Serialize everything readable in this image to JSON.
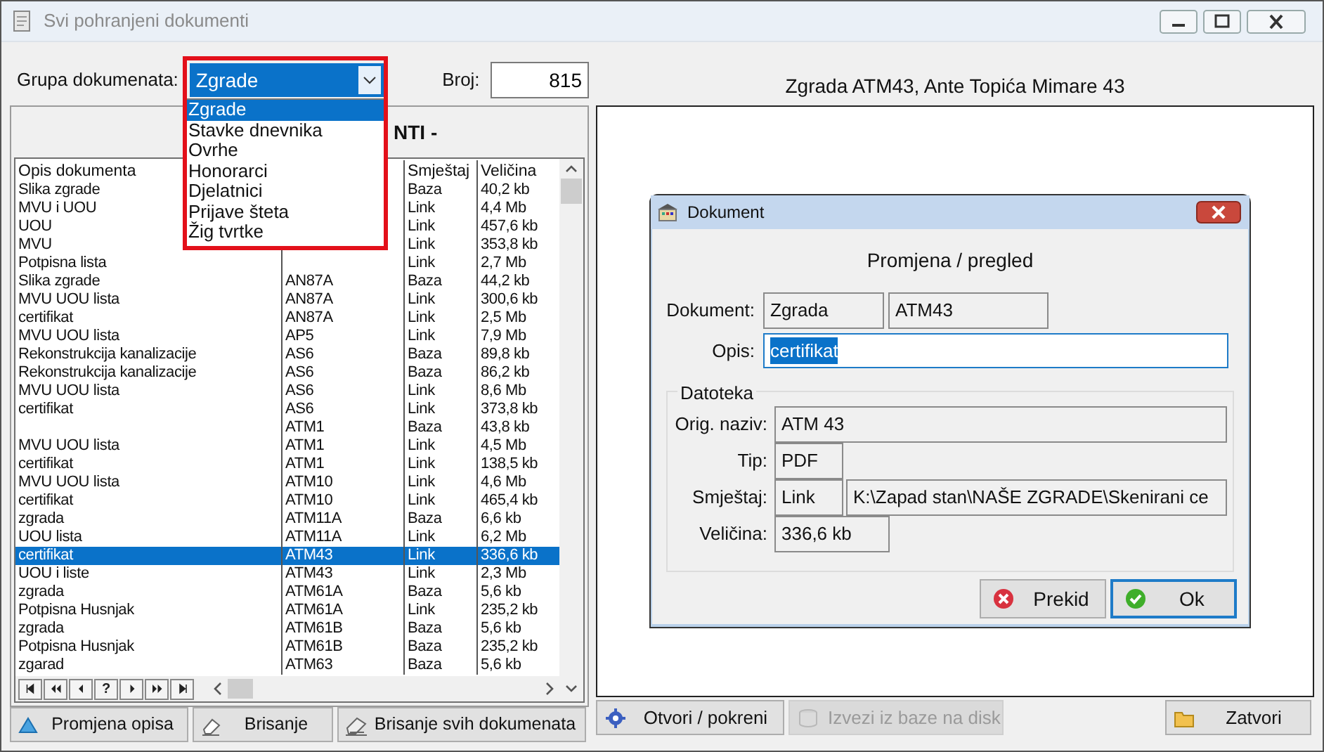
{
  "window": {
    "title": "Svi pohranjeni dokumenti"
  },
  "group_selector": {
    "label": "Grupa dokumenata:",
    "value": "Zgrade",
    "expanded": true,
    "options": [
      {
        "label": "Zgrade",
        "selected": true
      },
      {
        "label": "Stavke dnevnika",
        "selected": false
      },
      {
        "label": "Ovrhe",
        "selected": false
      },
      {
        "label": "Honorarci",
        "selected": false
      },
      {
        "label": "Djelatnici",
        "selected": false
      },
      {
        "label": "Prijave šteta",
        "selected": false
      },
      {
        "label": "Žig tvrtke",
        "selected": false
      }
    ]
  },
  "count": {
    "label": "Broj:",
    "value": "815"
  },
  "list_panel": {
    "heading": "NTI -",
    "columns": {
      "description": "Opis dokumenta",
      "location": "Smještaj",
      "size": "Veličina"
    },
    "rows": [
      {
        "description": "Slika zgrade",
        "location": "Baza",
        "size": "40,2 kb",
        "selected": false
      },
      {
        "description": "MVU i UOU",
        "location": "Link",
        "size": "4,4 Mb",
        "selected": false
      },
      {
        "description": "UOU",
        "location": "Link",
        "size": "457,6 kb",
        "selected": false
      },
      {
        "description": "MVU",
        "location": "Link",
        "size": "353,8 kb",
        "selected": false
      },
      {
        "description": "Potpisna lista",
        "location": "Link",
        "size": "2,7 Mb",
        "selected": false
      },
      {
        "description": "Slika zgrade",
        "code": "AN87A",
        "location": "Baza",
        "size": "44,2 kb",
        "selected": false
      },
      {
        "description": "MVU UOU lista",
        "code": "AN87A",
        "location": "Link",
        "size": "300,6 kb",
        "selected": false
      },
      {
        "description": "certifikat",
        "code": "AN87A",
        "location": "Link",
        "size": "2,5 Mb",
        "selected": false
      },
      {
        "description": "MVU UOU lista",
        "code": "AP5",
        "location": "Link",
        "size": "7,9 Mb",
        "selected": false
      },
      {
        "description": "Rekonstrukcija kanalizacije",
        "code": "AS6",
        "location": "Baza",
        "size": "89,8 kb",
        "selected": false
      },
      {
        "description": "Rekonstrukcija kanalizacije",
        "code": "AS6",
        "location": "Baza",
        "size": "86,2 kb",
        "selected": false
      },
      {
        "description": "MVU UOU lista",
        "code": "AS6",
        "location": "Link",
        "size": "8,6 Mb",
        "selected": false
      },
      {
        "description": "certifikat",
        "code": "AS6",
        "location": "Link",
        "size": "373,8 kb",
        "selected": false
      },
      {
        "code": "ATM1",
        "location": "Baza",
        "size": "43,8 kb",
        "selected": false
      },
      {
        "description": "MVU UOU lista",
        "code": "ATM1",
        "location": "Link",
        "size": "4,5 Mb",
        "selected": false
      },
      {
        "description": "certifikat",
        "code": "ATM1",
        "location": "Link",
        "size": "138,5 kb",
        "selected": false
      },
      {
        "description": "MVU UOU lista",
        "code": "ATM10",
        "location": "Link",
        "size": "4,6 Mb",
        "selected": false
      },
      {
        "description": "certifikat",
        "code": "ATM10",
        "location": "Link",
        "size": "465,4 kb",
        "selected": false
      },
      {
        "description": "zgrada",
        "code": "ATM11A",
        "location": "Baza",
        "size": "6,6 kb",
        "selected": false
      },
      {
        "description": "UOU lista",
        "code": "ATM11A",
        "location": "Link",
        "size": "6,2 Mb",
        "selected": false
      },
      {
        "description": "certifikat",
        "code": "ATM43",
        "location": "Link",
        "size": "336,6 kb",
        "selected": true
      },
      {
        "description": "UOU i liste",
        "code": "ATM43",
        "location": "Link",
        "size": "2,3 Mb",
        "selected": false
      },
      {
        "description": "zgrada",
        "code": "ATM61A",
        "location": "Baza",
        "size": "5,6 kb",
        "selected": false
      },
      {
        "description": "Potpisna Husnjak",
        "code": "ATM61A",
        "location": "Link",
        "size": "235,2 kb",
        "selected": false
      },
      {
        "description": "zgrada",
        "code": "ATM61B",
        "location": "Baza",
        "size": "5,6 kb",
        "selected": false
      },
      {
        "description": "Potpisna Husnjak",
        "code": "ATM61B",
        "location": "Baza",
        "size": "235,2 kb",
        "selected": false
      },
      {
        "description": "zgarad",
        "code": "ATM63",
        "location": "Baza",
        "size": "5,6 kb",
        "selected": false
      }
    ],
    "navigator_help": "?",
    "buttons": [
      {
        "label": "Promjena opisa"
      },
      {
        "label": "Brisanje"
      },
      {
        "label": "Brisanje svih dokumenata"
      }
    ]
  },
  "detail_panel": {
    "title": "Zgrada ATM43, Ante Topića Mimare 43",
    "buttons": [
      {
        "label": "Otvori / pokreni",
        "disabled": false
      },
      {
        "label": "Izvezi iz baze na disk",
        "disabled": true
      },
      {
        "label": "Zatvori",
        "disabled": false
      }
    ]
  },
  "dialog": {
    "title": "Dokument",
    "heading": "Promjena / pregled",
    "document_label": "Dokument:",
    "document_type": "Zgrada",
    "document_code": "ATM43",
    "description_label": "Opis:",
    "description_value": "certifikat",
    "description_selected": true,
    "file_group": {
      "title": "Datoteka",
      "original_name_label": "Orig. naziv:",
      "original_name": "ATM 43",
      "type_label": "Tip:",
      "type": "PDF",
      "location_label": "Smještaj:",
      "location": "Link",
      "path": "K:\\Zapad stan\\NAŠE ZGRADE\\Skenirani ce",
      "size_label": "Veličina:",
      "size": "336,6 kb"
    },
    "buttons": [
      {
        "label": "Prekid",
        "kind": "cancel",
        "default": false
      },
      {
        "label": "Ok",
        "kind": "confirm",
        "default": true
      }
    ]
  }
}
